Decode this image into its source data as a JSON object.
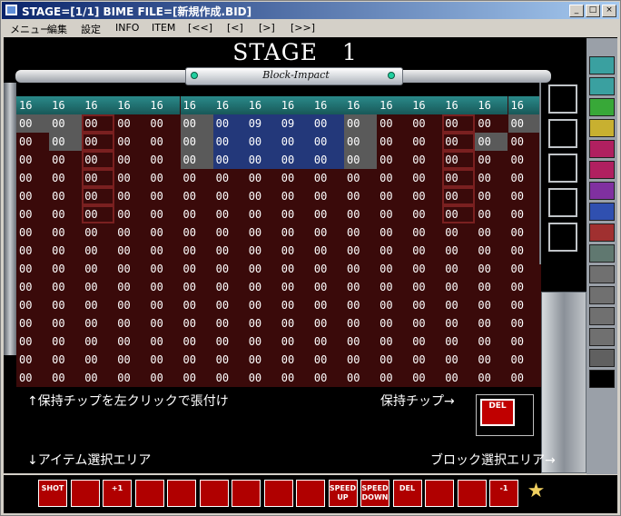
{
  "window": {
    "title": "STAGE=[1/1] BIME FILE=[新規作成.BID]",
    "min_label": "_",
    "max_label": "□",
    "close_label": "×"
  },
  "menu": [
    "メニュー",
    "編集",
    "設定",
    "INFO",
    "ITEM",
    "[<<]",
    "[<]",
    "[>]",
    "[>>]"
  ],
  "stage": {
    "title": "STAGE   1",
    "logo": "Block-Impact"
  },
  "grid": {
    "rows": [
      [
        "16",
        "16",
        "16",
        "16",
        "16",
        "16",
        "16",
        "16",
        "16",
        "16",
        "16",
        "16",
        "16",
        "16",
        "16",
        "16"
      ],
      [
        "00",
        "00",
        "00",
        "00",
        "00",
        "00",
        "00",
        "09",
        "09",
        "00",
        "00",
        "00",
        "00",
        "00",
        "00",
        "00"
      ],
      [
        "00",
        "00",
        "00",
        "00",
        "00",
        "00",
        "00",
        "00",
        "00",
        "00",
        "00",
        "00",
        "00",
        "00",
        "00",
        "00"
      ],
      [
        "00",
        "00",
        "00",
        "00",
        "00",
        "00",
        "00",
        "00",
        "00",
        "00",
        "00",
        "00",
        "00",
        "00",
        "00",
        "00"
      ],
      [
        "00",
        "00",
        "00",
        "00",
        "00",
        "00",
        "00",
        "00",
        "00",
        "00",
        "00",
        "00",
        "00",
        "00",
        "00",
        "00"
      ],
      [
        "00",
        "00",
        "00",
        "00",
        "00",
        "00",
        "00",
        "00",
        "00",
        "00",
        "00",
        "00",
        "00",
        "00",
        "00",
        "00"
      ],
      [
        "00",
        "00",
        "00",
        "00",
        "00",
        "00",
        "00",
        "00",
        "00",
        "00",
        "00",
        "00",
        "00",
        "00",
        "00",
        "00"
      ],
      [
        "00",
        "00",
        "00",
        "00",
        "00",
        "00",
        "00",
        "00",
        "00",
        "00",
        "00",
        "00",
        "00",
        "00",
        "00",
        "00"
      ],
      [
        "00",
        "00",
        "00",
        "00",
        "00",
        "00",
        "00",
        "00",
        "00",
        "00",
        "00",
        "00",
        "00",
        "00",
        "00",
        "00"
      ],
      [
        "00",
        "00",
        "00",
        "00",
        "00",
        "00",
        "00",
        "00",
        "00",
        "00",
        "00",
        "00",
        "00",
        "00",
        "00",
        "00"
      ],
      [
        "00",
        "00",
        "00",
        "00",
        "00",
        "00",
        "00",
        "00",
        "00",
        "00",
        "00",
        "00",
        "00",
        "00",
        "00",
        "00"
      ],
      [
        "00",
        "00",
        "00",
        "00",
        "00",
        "00",
        "00",
        "00",
        "00",
        "00",
        "00",
        "00",
        "00",
        "00",
        "00",
        "00"
      ],
      [
        "00",
        "00",
        "00",
        "00",
        "00",
        "00",
        "00",
        "00",
        "00",
        "00",
        "00",
        "00",
        "00",
        "00",
        "00",
        "00"
      ],
      [
        "00",
        "00",
        "00",
        "00",
        "00",
        "00",
        "00",
        "00",
        "00",
        "00",
        "00",
        "00",
        "00",
        "00",
        "00",
        "00"
      ],
      [
        "00",
        "00",
        "00",
        "00",
        "00",
        "00",
        "00",
        "00",
        "00",
        "00",
        "00",
        "00",
        "00",
        "00",
        "00",
        "00"
      ],
      [
        "00",
        "00",
        "00",
        "00",
        "00",
        "00",
        "00",
        "00",
        "00",
        "00",
        "00",
        "00",
        "00",
        "00",
        "00",
        "00"
      ]
    ],
    "stone_cells": [
      [
        1,
        0
      ],
      [
        1,
        1
      ],
      [
        1,
        5
      ],
      [
        1,
        10
      ],
      [
        1,
        15
      ],
      [
        2,
        1
      ],
      [
        2,
        5
      ],
      [
        2,
        10
      ],
      [
        2,
        14
      ],
      [
        3,
        5
      ],
      [
        3,
        10
      ]
    ],
    "blue_cells": [
      [
        1,
        6
      ],
      [
        1,
        7
      ],
      [
        1,
        8
      ],
      [
        1,
        9
      ],
      [
        2,
        6
      ],
      [
        2,
        7
      ],
      [
        2,
        8
      ],
      [
        2,
        9
      ],
      [
        3,
        6
      ],
      [
        3,
        7
      ],
      [
        3,
        8
      ],
      [
        3,
        9
      ]
    ],
    "red_cells": [
      [
        1,
        2
      ],
      [
        2,
        2
      ],
      [
        3,
        2
      ],
      [
        4,
        2
      ],
      [
        5,
        2
      ],
      [
        6,
        2
      ],
      [
        1,
        13
      ],
      [
        2,
        13
      ],
      [
        3,
        13
      ],
      [
        4,
        13
      ],
      [
        5,
        13
      ],
      [
        6,
        13
      ]
    ]
  },
  "info": {
    "hold_hint": "↑保持チップを左クリックで張付け",
    "held_label": "保持チップ→",
    "item_area": "↓アイテム選択エリア",
    "block_area": "ブロック選択エリア→",
    "held_chip_label": "DEL"
  },
  "items": [
    {
      "label": "SHOT",
      "icon": "shot-icon"
    },
    {
      "label": "",
      "icon": "paddle-up-icon"
    },
    {
      "label": "+1",
      "icon": "plus-one-icon"
    },
    {
      "label": "",
      "icon": "burst-icon"
    },
    {
      "label": "",
      "icon": "pillar-icon"
    },
    {
      "label": "",
      "icon": "coin-icon"
    },
    {
      "label": "",
      "icon": "drop-icon"
    },
    {
      "label": "",
      "icon": "flag-icon"
    },
    {
      "label": "",
      "icon": "rocket-icon"
    },
    {
      "label": "SPEED UP",
      "icon": "speed-up-icon"
    },
    {
      "label": "SPEED DOWN",
      "icon": "speed-down-icon"
    },
    {
      "label": "DEL",
      "icon": "delete-icon"
    },
    {
      "label": "",
      "icon": "camera-icon"
    },
    {
      "label": "",
      "icon": "film-icon"
    },
    {
      "label": "-1",
      "icon": "minus-one-icon"
    },
    {
      "label": "★",
      "icon": "star-icon"
    }
  ],
  "block_colors": [
    "#3aa0a0",
    "#3aa0a0",
    "#38a838",
    "#c8b030",
    "#b02060",
    "#b02060",
    "#8030a0",
    "#3050b0",
    "#a03030",
    "#607870",
    "#707070",
    "#707070",
    "#707070",
    "#707070",
    "#606060",
    "#000000"
  ]
}
